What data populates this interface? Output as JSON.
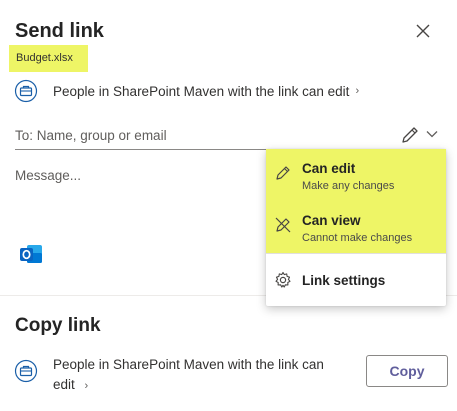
{
  "dialog": {
    "title": "Send link",
    "close_icon": "close-icon"
  },
  "file": {
    "name": "Budget.xlsx",
    "highlight_color": "#eef566"
  },
  "permission": {
    "text": "People in SharePoint Maven with the link can edit",
    "chevron": "›",
    "icon": "briefcase-globe-icon"
  },
  "to_field": {
    "placeholder": "To: Name, group or email",
    "value": "",
    "edit_icon": "pencil-icon",
    "caret_icon": "chevron-down-icon"
  },
  "message": {
    "placeholder": "Message...",
    "value": ""
  },
  "share_via": {
    "outlook_icon": "outlook-icon"
  },
  "copy_link": {
    "title": "Copy link",
    "text_line1": "People in SharePoint Maven with the link can",
    "text_line2": "edit",
    "chevron": "›",
    "button": "Copy"
  },
  "dropdown": {
    "items": [
      {
        "label": "Can edit",
        "sub": "Make any changes",
        "icon": "pencil-icon",
        "selected": true
      },
      {
        "label": "Can view",
        "sub": "Cannot make changes",
        "icon": "pencil-slash-icon",
        "selected": false
      }
    ],
    "settings_label": "Link settings",
    "settings_icon": "gear-icon"
  },
  "colors": {
    "highlight": "#eef566",
    "accent": "#605e9c",
    "outlook_blue": "#0a64c2"
  }
}
